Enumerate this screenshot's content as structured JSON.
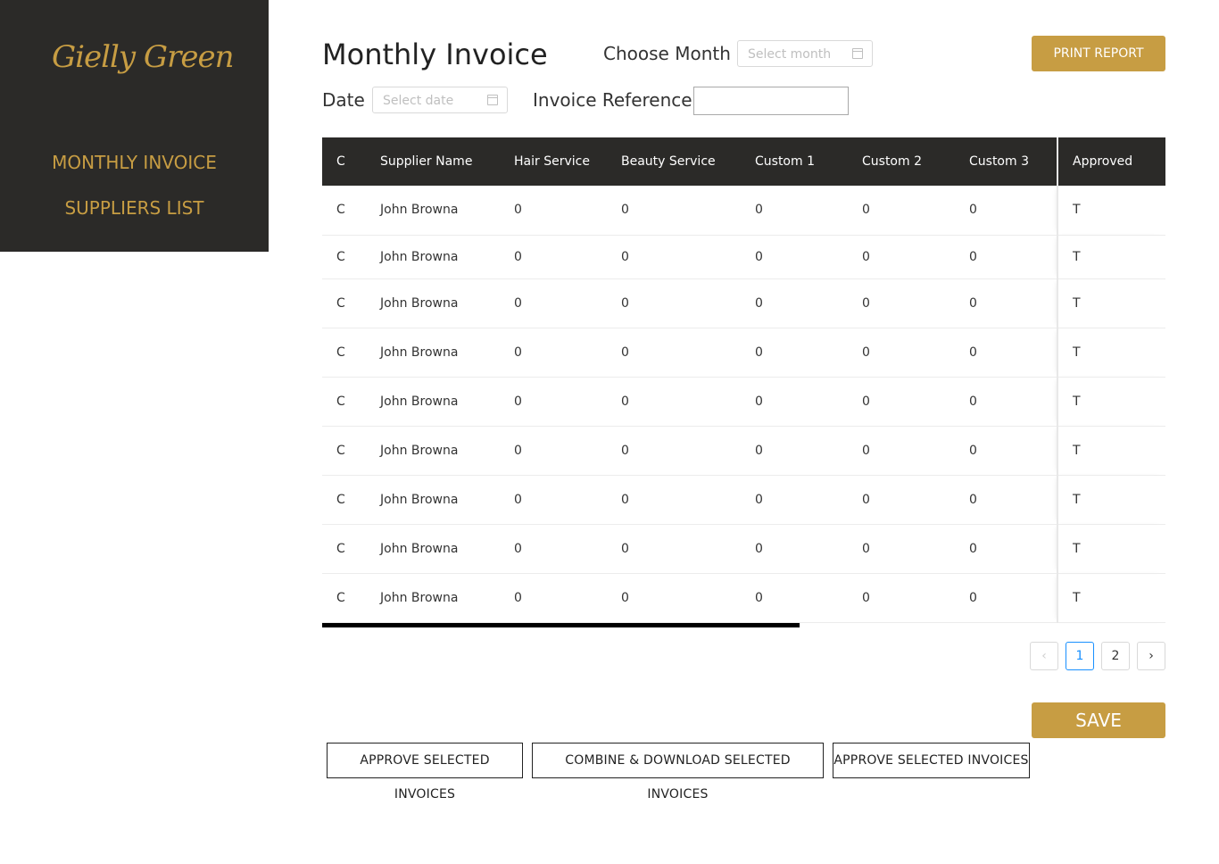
{
  "brand": {
    "logo_text": "Gielly Green"
  },
  "sidebar": {
    "items": [
      {
        "label": "MONTHLY INVOICE"
      },
      {
        "label": "SUPPLIERS LIST"
      }
    ]
  },
  "header": {
    "title": "Monthly Invoice",
    "choose_month_label": "Choose Month",
    "month_placeholder": "Select month",
    "date_label": "Date",
    "date_placeholder": "Select date",
    "invoice_ref_label": "Invoice Reference",
    "invoice_ref_value": "",
    "print_label": "PRINT REPORT"
  },
  "table": {
    "columns": [
      "C",
      "Supplier Name",
      "Hair Service",
      "Beauty Service",
      "Custom 1",
      "Custom 2",
      "Custom 3",
      "Approved"
    ],
    "rows": [
      [
        "C",
        "John Browna",
        "0",
        "0",
        "0",
        "0",
        "0",
        "T"
      ],
      [
        "C",
        "John Browna",
        "0",
        "0",
        "0",
        "0",
        "0",
        "T"
      ],
      [
        "C",
        "John Browna",
        "0",
        "0",
        "0",
        "0",
        "0",
        "T"
      ],
      [
        "C",
        "John Browna",
        "0",
        "0",
        "0",
        "0",
        "0",
        "T"
      ],
      [
        "C",
        "John Browna",
        "0",
        "0",
        "0",
        "0",
        "0",
        "T"
      ],
      [
        "C",
        "John Browna",
        "0",
        "0",
        "0",
        "0",
        "0",
        "T"
      ],
      [
        "C",
        "John Browna",
        "0",
        "0",
        "0",
        "0",
        "0",
        "T"
      ],
      [
        "C",
        "John Browna",
        "0",
        "0",
        "0",
        "0",
        "0",
        "T"
      ],
      [
        "C",
        "John Browna",
        "0",
        "0",
        "0",
        "0",
        "0",
        "T"
      ]
    ]
  },
  "pagination": {
    "prev_icon": "chevron-left-icon",
    "next_icon": "chevron-right-icon",
    "pages": [
      "1",
      "2"
    ],
    "current": "1"
  },
  "actions": {
    "save_label": "SAVE",
    "approve_left": "APPROVE SELECTED INVOICES",
    "combine_download": "COMBINE & DOWNLOAD SELECTED INVOICES",
    "approve_right": "APPROVE SELECTED INVOICES"
  },
  "colors": {
    "brand_gold": "#c79d43",
    "sidebar_bg": "#2b2a28",
    "active_page": "#1890ff"
  }
}
